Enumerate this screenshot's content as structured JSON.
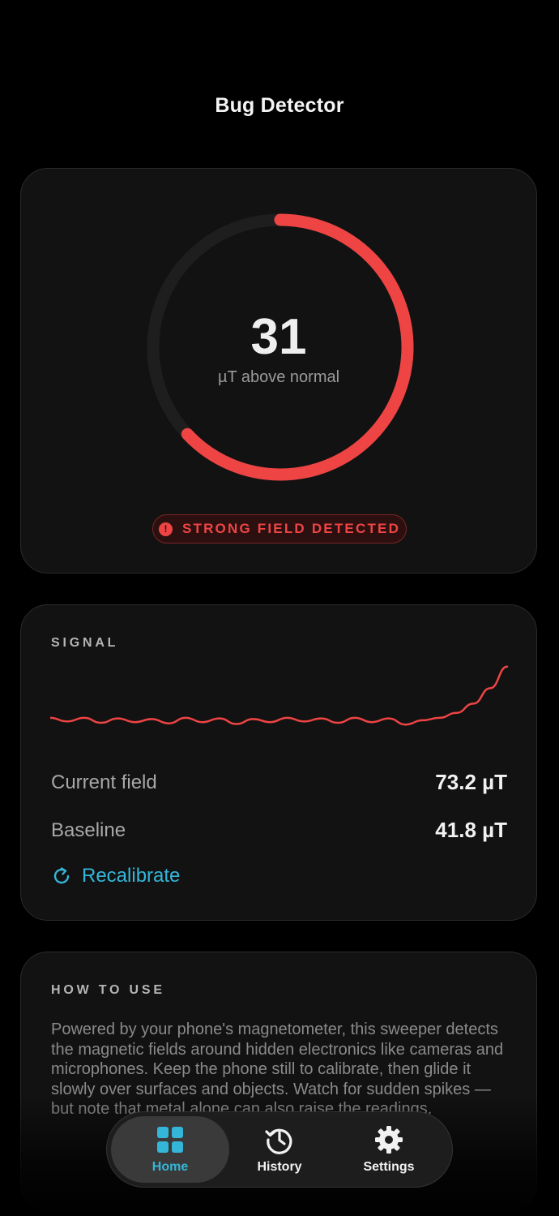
{
  "app": {
    "title": "Bug Detector"
  },
  "gauge": {
    "value": "31",
    "unit": "µT above normal",
    "fill_fraction": 0.63,
    "color": "#ef4444",
    "track_color": "#1e1e1e"
  },
  "status_badge": {
    "icon": "alert-icon",
    "text": "STRONG FIELD DETECTED",
    "color": "#ef4444"
  },
  "signal": {
    "section_label": "SIGNAL",
    "current_label": "Current field",
    "current_value": "73.2 µT",
    "baseline_label": "Baseline",
    "baseline_value": "41.8 µT",
    "recalibrate_label": "Recalibrate",
    "line_color": "#ef4444"
  },
  "chart_data": {
    "type": "line",
    "title": "",
    "xlabel": "",
    "ylabel": "",
    "series": [
      {
        "values": [
          0.12,
          0.06,
          0.12,
          0.04,
          0.11,
          0.05,
          0.1,
          0.03,
          0.12,
          0.05,
          0.11,
          0.02,
          0.1,
          0.05,
          0.12,
          0.06,
          0.11,
          0.04,
          0.12,
          0.05,
          0.11,
          0.01,
          0.08,
          0.12,
          0.2,
          0.35,
          0.6,
          0.95
        ]
      }
    ]
  },
  "how_to": {
    "section_label": "HOW TO USE",
    "text": "Powered by your phone's magnetometer, this sweeper detects the magnetic fields around hidden electronics like cameras and microphones. Keep the phone still to calibrate, then glide it slowly over surfaces and objects. Watch for sudden spikes — but note that metal alone can also raise the readings."
  },
  "tabs": [
    {
      "label": "Home",
      "icon": "grid-icon",
      "active": true
    },
    {
      "label": "History",
      "icon": "history-icon",
      "active": false
    },
    {
      "label": "Settings",
      "icon": "gear-icon",
      "active": false
    }
  ],
  "accent_color": "#34b6d9"
}
